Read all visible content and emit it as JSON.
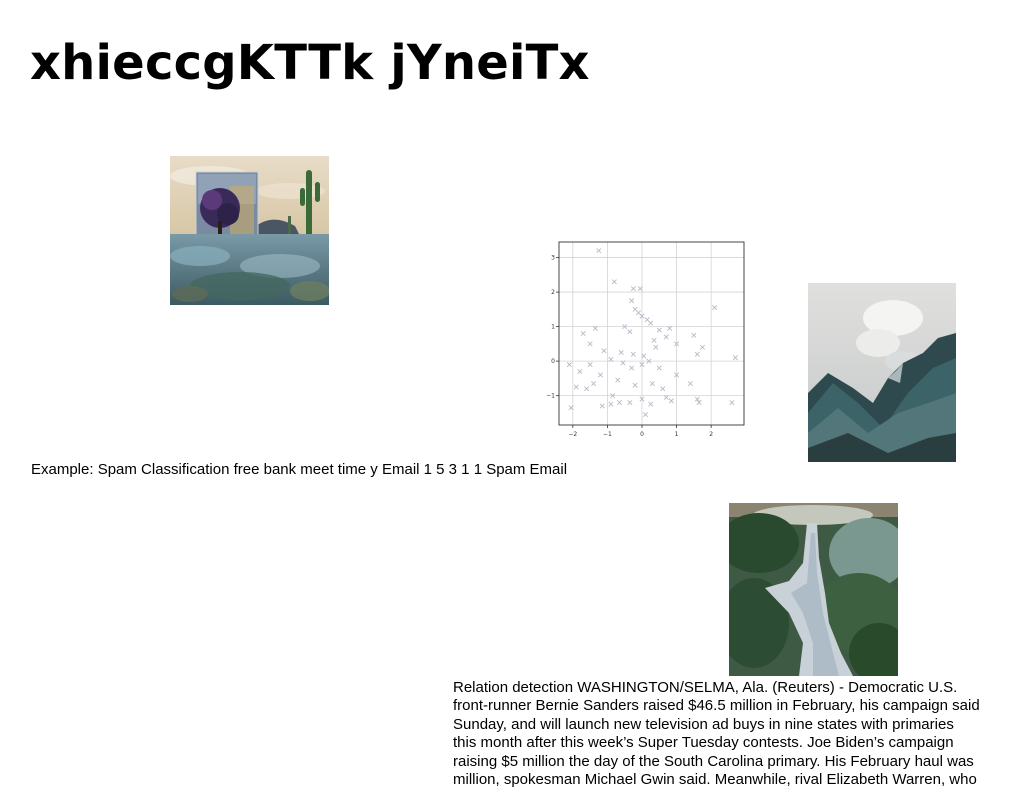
{
  "page": {
    "title": "xhieccgKTTk jYneiTx"
  },
  "images": {
    "desert": "desert-cube-cactus-photo",
    "mountain": "misty-mountain-ridge-photo",
    "path": "grassy-dune-path-photo"
  },
  "caption": "Example: Spam Classification free bank meet time y Email 1 5 3 1 1 Spam Email",
  "article": {
    "lines": [
      "Relation detection WASHINGTON/SELMA, Ala. (Reuters) - Democratic U.S.",
      "front-runner Bernie Sanders raised $46.5 million in February, his campaign said",
      "Sunday, and will launch new television ad buys in nine states with primaries",
      "this month after this week’s Super Tuesday contests. Joe Biden’s campaign",
      "raising $5 million the day of the South Carolina primary. His February haul was",
      "million, spokesman Michael Gwin said. Meanwhile, rival Elizabeth Warren, who"
    ]
  },
  "chart_data": {
    "type": "scatter",
    "marker": "x",
    "color": "#b8b8c8",
    "grid": true,
    "xlim": [
      -2.4,
      2.95
    ],
    "ylim": [
      -1.85,
      3.45
    ],
    "xticks": [
      -2,
      -1,
      0,
      1,
      2
    ],
    "yticks": [
      -1,
      0,
      1,
      2,
      3
    ],
    "xticklabels": [
      "−2",
      "−1",
      "0",
      "1",
      "2"
    ],
    "yticklabels": [
      "−1",
      "0",
      "1",
      "2",
      "3"
    ],
    "points": [
      [
        -1.25,
        3.2
      ],
      [
        -0.8,
        2.3
      ],
      [
        -0.25,
        2.1
      ],
      [
        -0.05,
        2.1
      ],
      [
        -0.3,
        1.75
      ],
      [
        -0.2,
        1.5
      ],
      [
        -0.1,
        1.4
      ],
      [
        0.0,
        1.3
      ],
      [
        0.15,
        1.2
      ],
      [
        0.25,
        1.1
      ],
      [
        2.1,
        1.55
      ],
      [
        -1.7,
        0.8
      ],
      [
        -1.35,
        0.95
      ],
      [
        -0.5,
        1.0
      ],
      [
        -0.35,
        0.85
      ],
      [
        0.5,
        0.9
      ],
      [
        0.8,
        0.95
      ],
      [
        0.7,
        0.7
      ],
      [
        0.35,
        0.6
      ],
      [
        -1.5,
        0.5
      ],
      [
        -1.1,
        0.3
      ],
      [
        -0.6,
        0.25
      ],
      [
        -0.25,
        0.2
      ],
      [
        0.05,
        0.15
      ],
      [
        0.4,
        0.4
      ],
      [
        1.0,
        0.5
      ],
      [
        1.5,
        0.75
      ],
      [
        1.75,
        0.4
      ],
      [
        1.6,
        0.2
      ],
      [
        2.7,
        0.1
      ],
      [
        -2.1,
        -0.1
      ],
      [
        -1.8,
        -0.3
      ],
      [
        -1.5,
        -0.1
      ],
      [
        -1.2,
        -0.4
      ],
      [
        -0.9,
        0.05
      ],
      [
        -0.55,
        -0.05
      ],
      [
        -0.3,
        -0.2
      ],
      [
        0.0,
        -0.1
      ],
      [
        0.2,
        0.0
      ],
      [
        0.5,
        -0.2
      ],
      [
        -1.9,
        -0.75
      ],
      [
        -1.6,
        -0.8
      ],
      [
        -1.4,
        -0.65
      ],
      [
        -0.7,
        -0.55
      ],
      [
        -0.2,
        -0.7
      ],
      [
        0.3,
        -0.65
      ],
      [
        0.6,
        -0.8
      ],
      [
        1.0,
        -0.4
      ],
      [
        1.4,
        -0.65
      ],
      [
        -0.85,
        -1.0
      ],
      [
        -0.65,
        -1.2
      ],
      [
        -0.35,
        -1.2
      ],
      [
        0.0,
        -1.1
      ],
      [
        0.25,
        -1.25
      ],
      [
        0.7,
        -1.05
      ],
      [
        1.6,
        -1.1
      ],
      [
        2.6,
        -1.2
      ],
      [
        -2.05,
        -1.35
      ],
      [
        -1.15,
        -1.3
      ],
      [
        -0.9,
        -1.25
      ],
      [
        0.1,
        -1.55
      ],
      [
        0.85,
        -1.15
      ],
      [
        1.65,
        -1.2
      ]
    ]
  }
}
